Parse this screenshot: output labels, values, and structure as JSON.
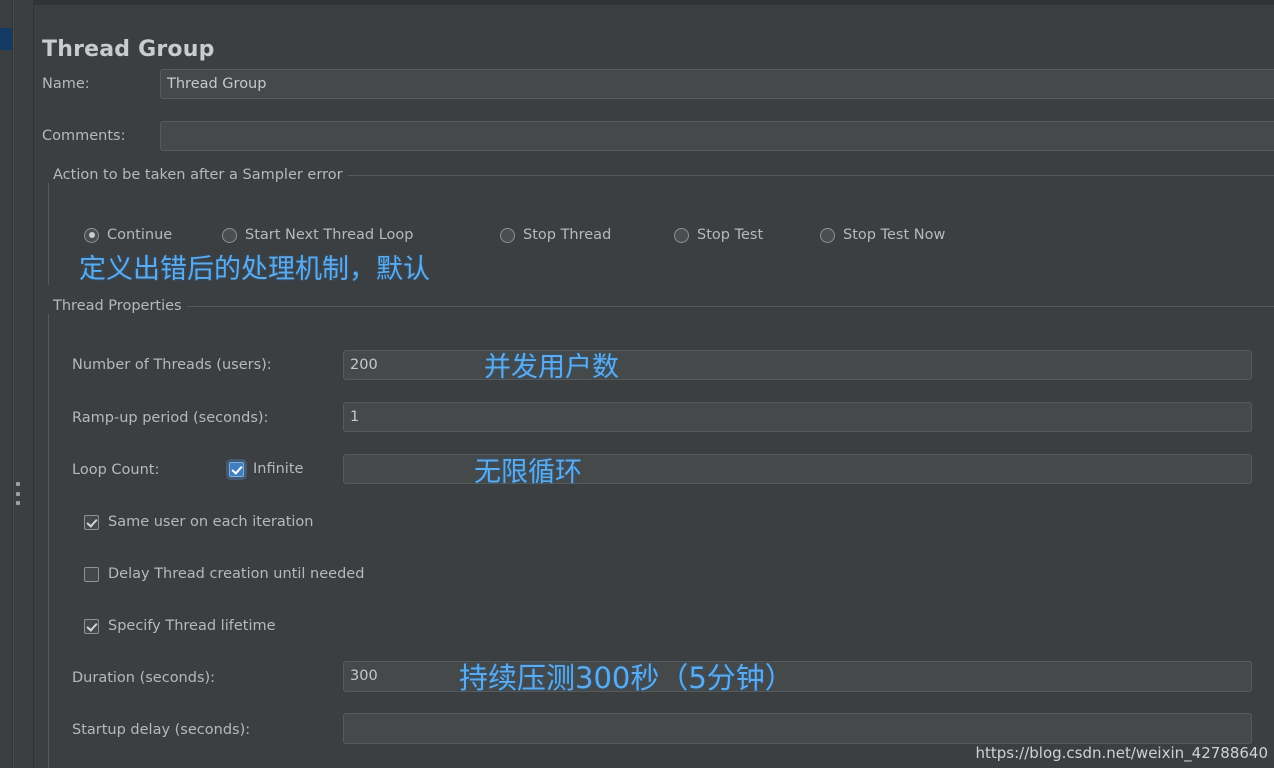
{
  "window": {
    "title": "Thread Group"
  },
  "fields": {
    "name": {
      "label": "Name:",
      "value": "Thread Group"
    },
    "comments": {
      "label": "Comments:",
      "value": ""
    }
  },
  "sampler_error_group": {
    "legend": "Action to be taken after a Sampler error",
    "options": [
      {
        "label": "Continue",
        "selected": true
      },
      {
        "label": "Start Next Thread Loop",
        "selected": false
      },
      {
        "label": "Stop Thread",
        "selected": false
      },
      {
        "label": "Stop Test",
        "selected": false
      },
      {
        "label": "Stop Test Now",
        "selected": false
      }
    ]
  },
  "thread_properties": {
    "legend": "Thread Properties",
    "number_of_threads": {
      "label": "Number of Threads (users):",
      "value": "200"
    },
    "ramp_up": {
      "label": "Ramp-up period (seconds):",
      "value": "1"
    },
    "loop_count": {
      "label": "Loop Count:",
      "infinite_label": "Infinite",
      "infinite_checked": true,
      "value": ""
    },
    "same_user": {
      "label": "Same user on each iteration",
      "checked": true
    },
    "delay_thread": {
      "label": "Delay Thread creation until needed",
      "checked": false
    },
    "specify_lifetime": {
      "label": "Specify Thread lifetime",
      "checked": true
    },
    "duration": {
      "label": "Duration (seconds):",
      "value": "300"
    },
    "startup_delay": {
      "label": "Startup delay (seconds):",
      "value": ""
    }
  },
  "annotations": {
    "error_handling": "定义出错后的处理机制，默认",
    "concurrent_users": "并发用户数",
    "infinite_loop": "无限循环",
    "duration_note": "持续压测300秒（5分钟）"
  },
  "watermark": "https://blog.csdn.net/weixin_42788640",
  "colors": {
    "background": "#3c3f41",
    "field": "#45494a",
    "text": "#b6b9bb",
    "annotation": "#5aabf0",
    "accent": "#3f7fbf",
    "selection": "#123a63"
  }
}
